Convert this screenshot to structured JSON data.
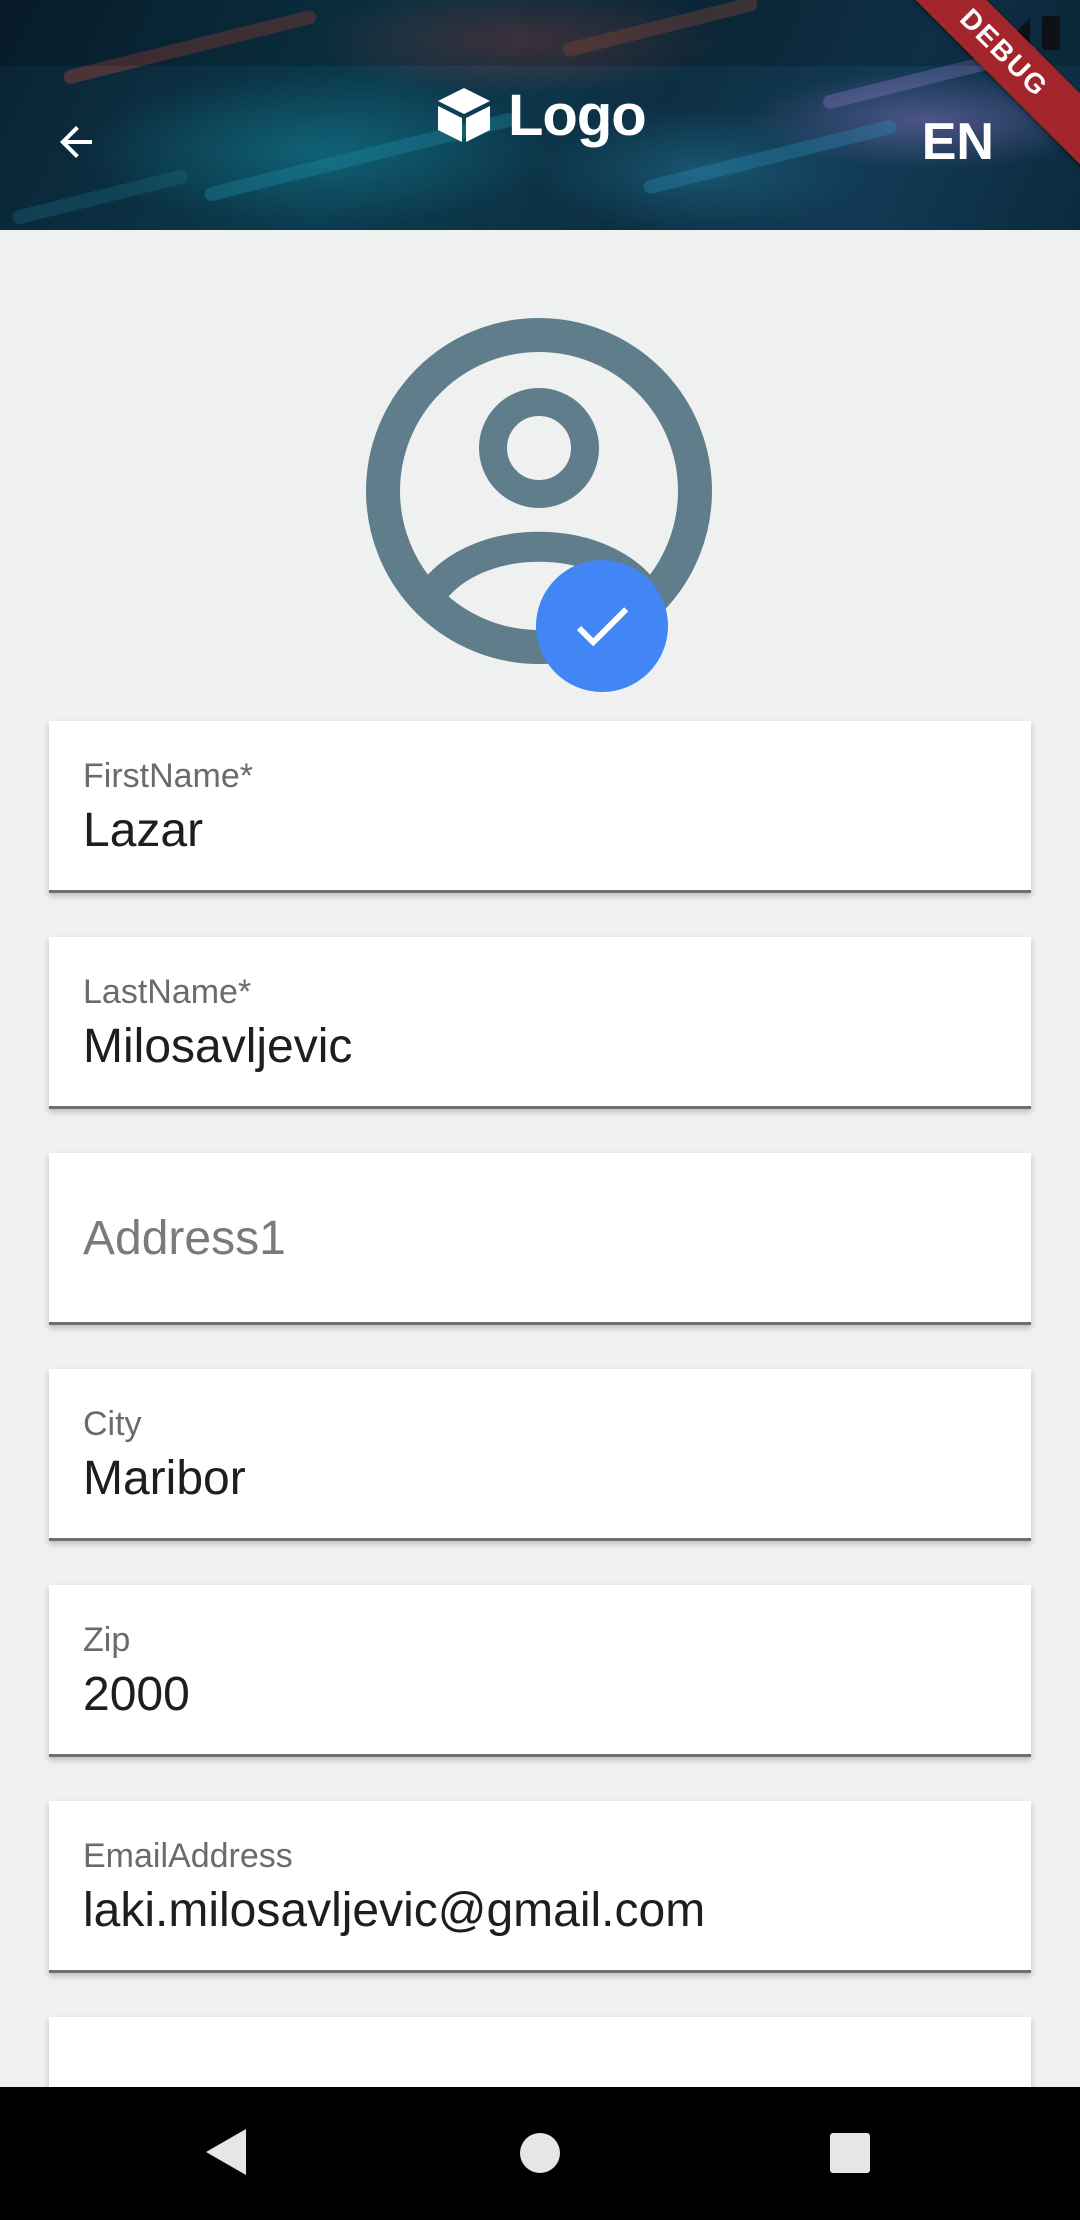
{
  "header": {
    "logo_text": "Logo",
    "language": "EN",
    "debug_banner": "DEBUG"
  },
  "form": {
    "first_name": {
      "label": "FirstName*",
      "value": "Lazar"
    },
    "last_name": {
      "label": "LastName*",
      "value": "Milosavljevic"
    },
    "address1": {
      "placeholder": "Address1",
      "value": ""
    },
    "city": {
      "label": "City",
      "value": "Maribor"
    },
    "zip": {
      "label": "Zip",
      "value": "2000"
    },
    "email": {
      "label": "EmailAddress",
      "value": "laki.milosavljevic@gmail.com"
    }
  },
  "icons": {
    "back": "arrow-back-icon",
    "logo": "cube-icon",
    "avatar": "account-circle-icon",
    "avatar_check": "check-icon",
    "nav_back": "triangle-back-icon",
    "nav_home": "circle-home-icon",
    "nav_recents": "square-recents-icon"
  },
  "colors": {
    "accent": "#4285f4",
    "avatar": "#607d8b",
    "debug_banner": "#a3262d",
    "background": "#eff1f1"
  }
}
